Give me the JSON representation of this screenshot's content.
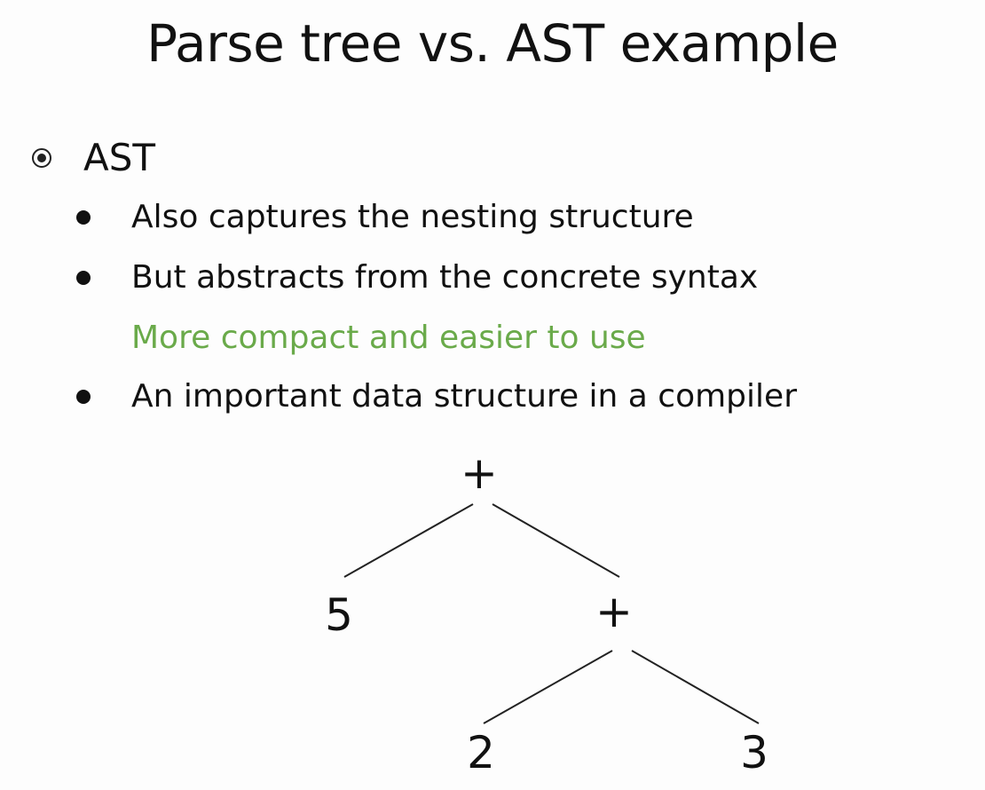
{
  "slide": {
    "title": "Parse tree vs. AST example",
    "section": "AST",
    "bullets": [
      "Also captures the nesting structure",
      "But abstracts from the concrete syntax",
      "An important data structure in a compiler"
    ],
    "note": "More compact and easier to use",
    "note_color": "#6aaa4a"
  },
  "tree": {
    "root": "+",
    "left_leaf": "5",
    "inner_node": "+",
    "inner_left": "2",
    "inner_right": "3"
  }
}
